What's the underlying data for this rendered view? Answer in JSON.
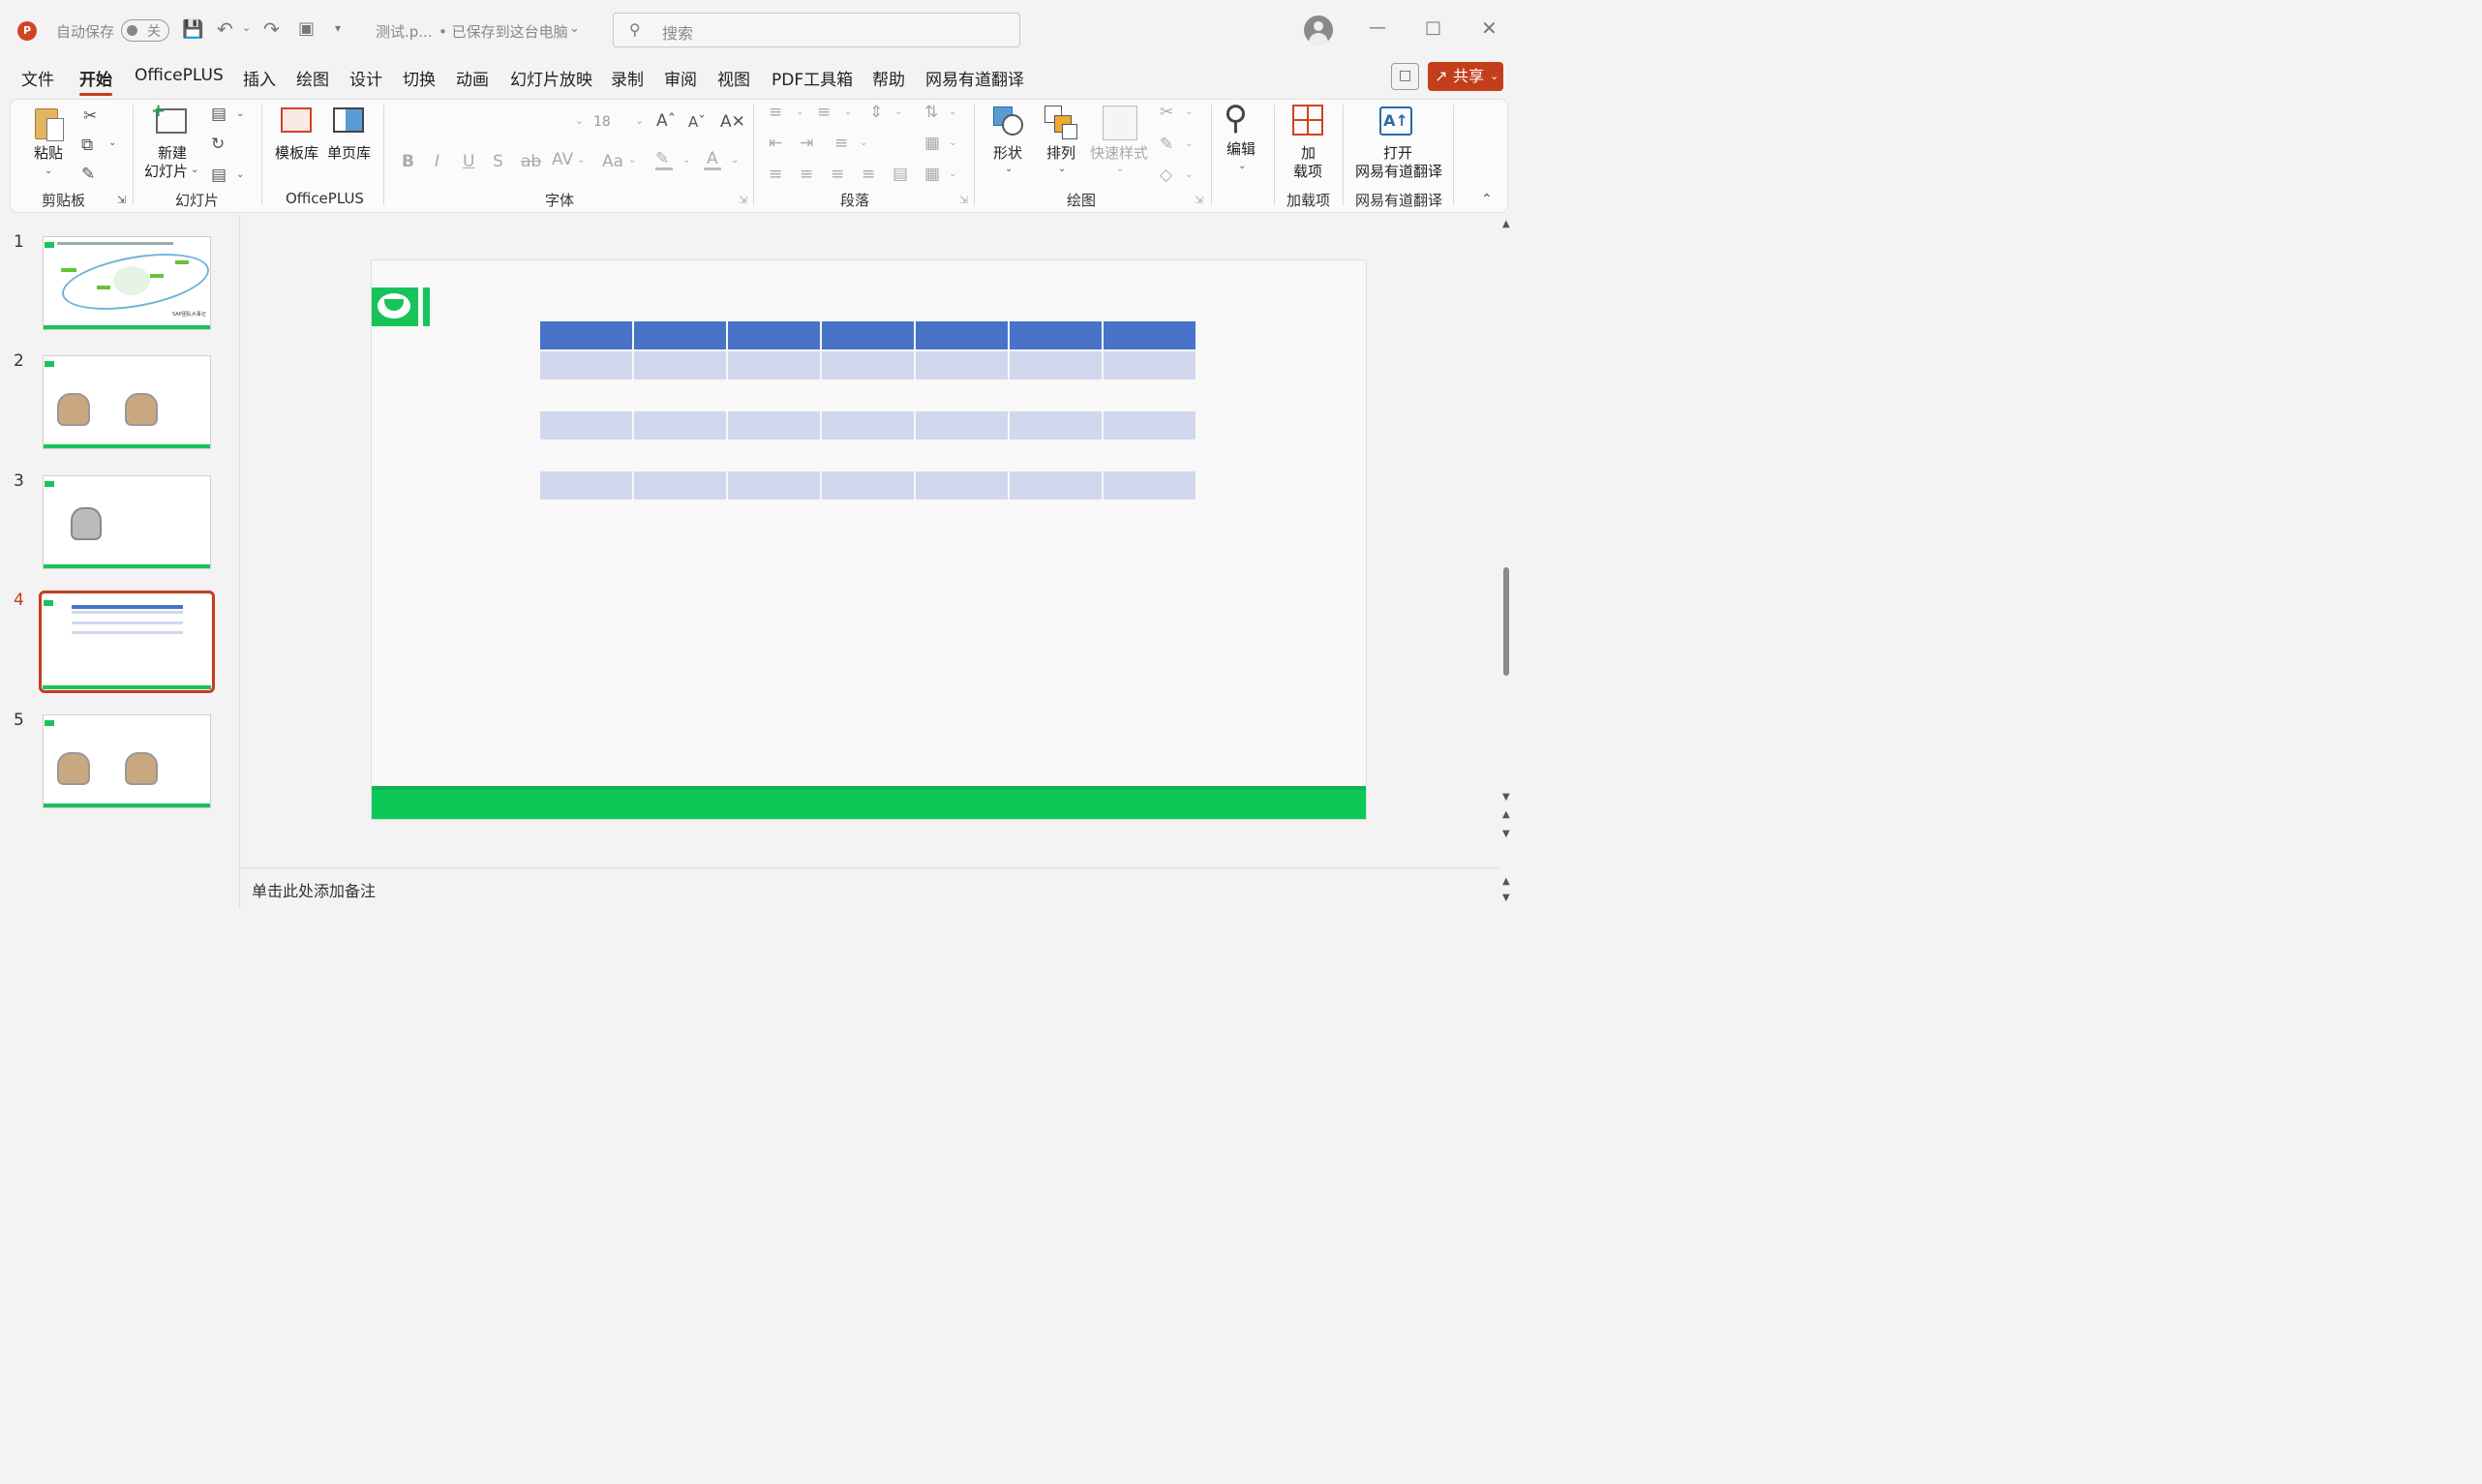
{
  "titlebar": {
    "app_icon": "powerpoint-app-icon",
    "autosave_label": "自动保存",
    "autosave_state": "关",
    "filename": "测试.p...",
    "save_status": "• 已保存到这台电脑",
    "search_placeholder": "搜索"
  },
  "menu_tabs": [
    "文件",
    "开始",
    "OfficePLUS",
    "插入",
    "绘图",
    "设计",
    "切换",
    "动画",
    "幻灯片放映",
    "录制",
    "审阅",
    "视图",
    "PDF工具箱",
    "帮助",
    "网易有道翻译"
  ],
  "active_tab": "开始",
  "share_label": "共享",
  "ribbon": {
    "clipboard": {
      "paste": "粘贴",
      "group": "剪贴板"
    },
    "slides": {
      "new_slide_line1": "新建",
      "new_slide_line2": "幻灯片",
      "group": "幻灯片"
    },
    "officeplus": {
      "template_lib": "模板库",
      "single_page_lib": "单页库",
      "group": "OfficePLUS"
    },
    "font": {
      "size": "18",
      "group": "字体",
      "bold": "B",
      "italic": "I",
      "underline": "U",
      "shadow": "S",
      "strike": "ab",
      "spacing": "AV",
      "case": "Aa",
      "color_letter": "A"
    },
    "paragraph": {
      "group": "段落"
    },
    "drawing": {
      "shapes": "形状",
      "arrange": "排列",
      "quick_styles": "快速样式",
      "group": "绘图"
    },
    "editing": {
      "edit": "编辑"
    },
    "addins": {
      "line1": "加",
      "line2": "载项",
      "group": "加载项"
    },
    "youdao": {
      "line1": "打开",
      "line2": "网易有道翻译",
      "group": "网易有道翻译"
    }
  },
  "slides_panel": {
    "numbers": [
      "1",
      "2",
      "3",
      "4",
      "5"
    ],
    "selected": "4",
    "slide1_caption": "SAP团队大事记"
  },
  "notes_placeholder": "单击此处添加备注",
  "colors": {
    "accent": "#c43e1c",
    "table_header": "#4873c8",
    "table_light": "#d1d7ec",
    "brand_green": "#17c45a"
  }
}
